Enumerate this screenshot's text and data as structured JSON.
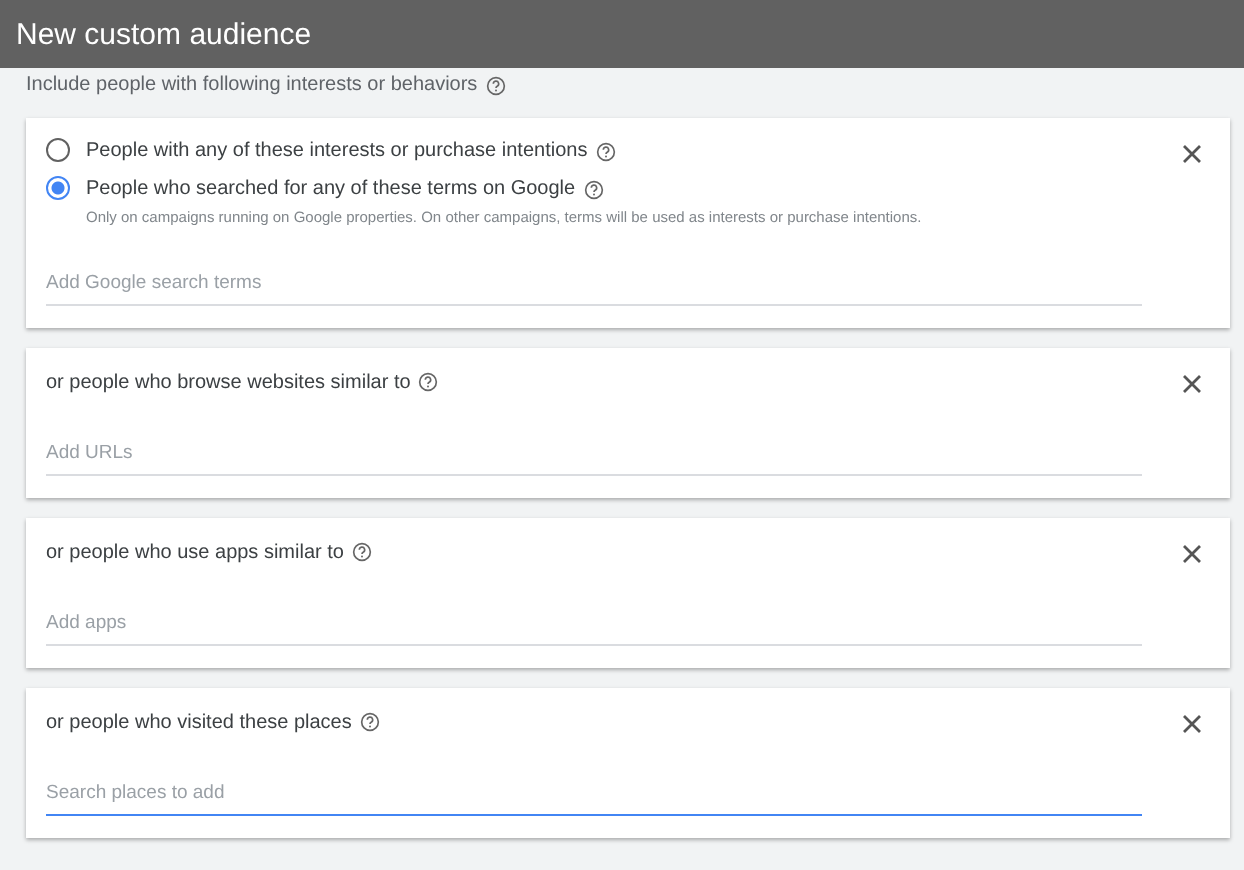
{
  "window": {
    "title": "New custom audience"
  },
  "intro": "Include people with following interests or behaviors",
  "cards": [
    {
      "options": [
        {
          "label": "People with any of these interests or purchase intentions",
          "selected": false
        },
        {
          "label": "People who searched for any of these terms on Google",
          "selected": true,
          "note": "Only on campaigns running on Google properties. On other campaigns, terms will be used as interests or purchase intentions."
        }
      ],
      "field": {
        "placeholder": "Add Google search terms",
        "focused": false
      }
    },
    {
      "title": "or people who browse websites similar to",
      "field": {
        "placeholder": "Add URLs",
        "focused": false
      }
    },
    {
      "title": "or people who use apps similar to",
      "field": {
        "placeholder": "Add apps",
        "focused": false
      }
    },
    {
      "title": "or people who visited these places",
      "field": {
        "placeholder": "Search places to add",
        "focused": true
      }
    }
  ]
}
